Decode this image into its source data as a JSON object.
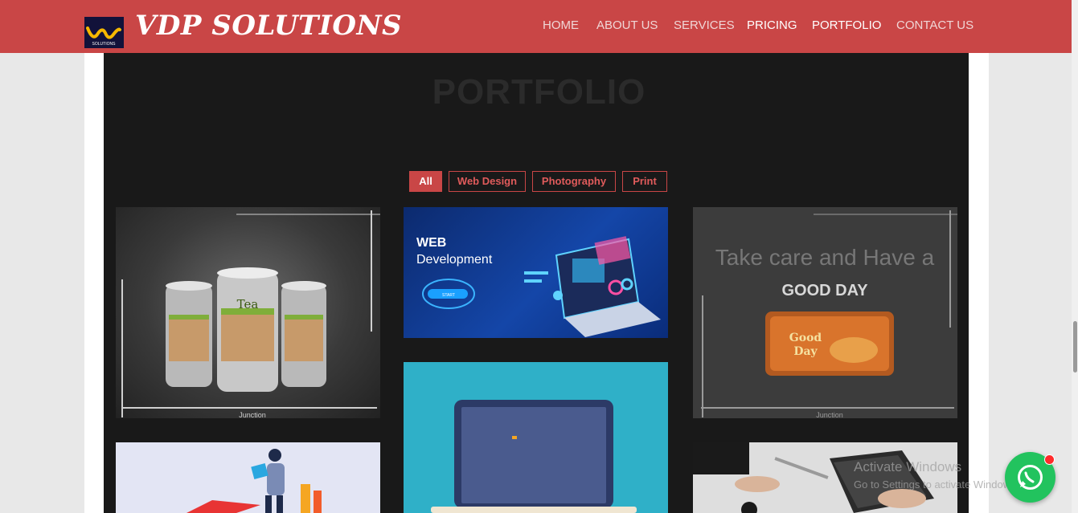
{
  "header": {
    "brand": "VDP SOLUTIONS",
    "logo_text": "SOLUTIONS",
    "nav": [
      {
        "label": "HOME",
        "active": false
      },
      {
        "label": "ABOUT US",
        "active": false
      },
      {
        "label": "SERVICES",
        "active": false
      },
      {
        "label": "PRICING",
        "active": true
      },
      {
        "label": "PORTFOLIO",
        "active": true
      },
      {
        "label": "CONTACT US",
        "active": false
      }
    ]
  },
  "portfolio": {
    "title": "PORTFOLIO",
    "filters": [
      {
        "label": "All",
        "active": true
      },
      {
        "label": "Web Design",
        "active": false
      },
      {
        "label": "Photography",
        "active": false
      },
      {
        "label": "Print",
        "active": false
      }
    ],
    "items": {
      "tea": {
        "label": "Tea",
        "footer": "Junction"
      },
      "web": {
        "line1": "WEB",
        "line2": "Development",
        "start": "START"
      },
      "goodday": {
        "headline": "Take care and Have a",
        "subline": "GOOD DAY",
        "pack1": "Good",
        "pack2": "Day",
        "footer": "Junction"
      }
    }
  },
  "overlay": {
    "activate_title": "Activate Windows",
    "activate_sub": "Go to Settings to activate Windows."
  },
  "colors": {
    "brand": "#c94646",
    "panel": "#191919",
    "whatsapp": "#22c35e"
  }
}
